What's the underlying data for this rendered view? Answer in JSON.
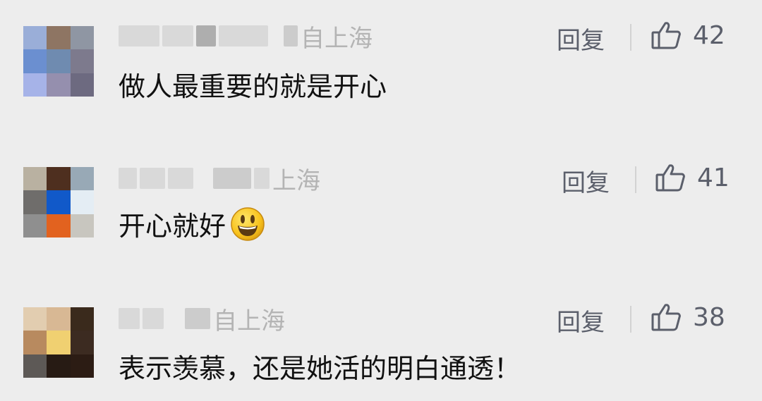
{
  "comments": [
    {
      "meta_visible": "自上海",
      "text": "做人最重要的就是开心",
      "reply_label": "回复",
      "like_count": "42",
      "avatar_colors": [
        "#9aaed8",
        "#8e7563",
        "#8f96a3",
        "#6b8fd0",
        "#6f8bb0",
        "#7d7a8d",
        "#a6b3e8",
        "#958fae",
        "#6d6a80"
      ]
    },
    {
      "meta_visible": "上海",
      "text": "开心就好",
      "emoji": "grinning-face-emoji",
      "reply_label": "回复",
      "like_count": "41",
      "avatar_colors": [
        "#b9b1a1",
        "#4e2f1f",
        "#98a9b6",
        "#6f6d6b",
        "#1159c9",
        "#e4edf4",
        "#8f8f8f",
        "#e2621f",
        "#c8c6bf"
      ]
    },
    {
      "meta_visible": "自上海",
      "text": "表示羡慕，还是她活的明白通透！",
      "reply_label": "回复",
      "like_count": "38",
      "avatar_colors": [
        "#e2cdb0",
        "#d8b894",
        "#3a2a1c",
        "#b88a5f",
        "#f0d071",
        "#3c2b21",
        "#5d5956",
        "#271b14",
        "#2c1c14"
      ]
    }
  ],
  "colors": {
    "background": "#ededed",
    "text": "#111111",
    "meta": "#b4b4b4",
    "action": "#5b5f6b"
  },
  "icons": {
    "like": "thumbs-up-icon",
    "emoji": "grinning-face-emoji"
  }
}
